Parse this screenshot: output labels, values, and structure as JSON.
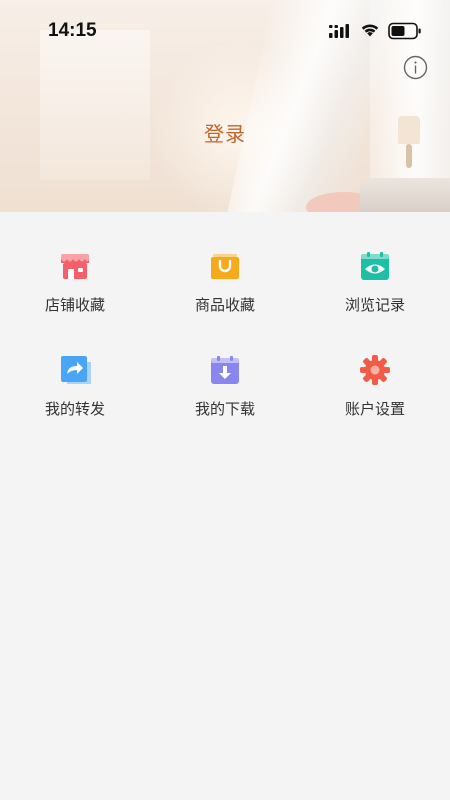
{
  "status_bar": {
    "time": "14:15"
  },
  "header": {
    "login_label": "登录",
    "info_icon": "info-icon"
  },
  "grid": {
    "items": [
      {
        "label": "店铺收藏",
        "icon": "store-icon",
        "color": "#f3606a"
      },
      {
        "label": "商品收藏",
        "icon": "shopping-bag-icon",
        "color": "#f7a91c"
      },
      {
        "label": "浏览记录",
        "icon": "eye-calendar-icon",
        "color": "#1fbfa6"
      },
      {
        "label": "我的转发",
        "icon": "share-icon",
        "color": "#4aa5f7"
      },
      {
        "label": "我的下载",
        "icon": "download-icon",
        "color": "#8a86f0"
      },
      {
        "label": "账户设置",
        "icon": "gear-icon",
        "color": "#f25b45"
      }
    ]
  },
  "colors": {
    "accent": "#c3642a",
    "background": "#f4f4f4"
  }
}
